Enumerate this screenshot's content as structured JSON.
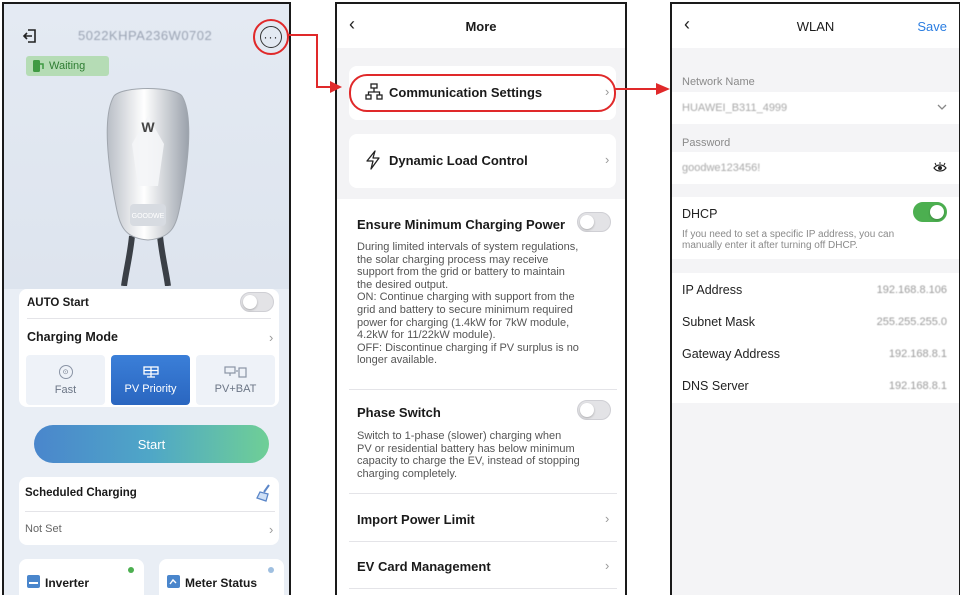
{
  "screen1": {
    "device_serial": "5022KHPA236W0702",
    "status": "Waiting",
    "charger_brand": "GOODWE",
    "auto_start": {
      "label": "AUTO Start",
      "enabled": false
    },
    "charging_mode": {
      "title": "Charging Mode",
      "modes": [
        {
          "label": "Fast",
          "active": false
        },
        {
          "label": "PV Priority",
          "active": true
        },
        {
          "label": "PV+BAT",
          "active": false
        }
      ]
    },
    "start_label": "Start",
    "scheduled": {
      "title": "Scheduled Charging",
      "value": "Not Set"
    },
    "tiles": [
      {
        "label": "Inverter",
        "status_color": "#4caf50"
      },
      {
        "label": "Meter Status",
        "status_color": "#9fbfe0"
      }
    ]
  },
  "screen2": {
    "title": "More",
    "communication_settings": "Communication Settings",
    "dynamic_load_control": "Dynamic Load Control",
    "ensure_min": {
      "label": "Ensure Minimum Charging Power",
      "enabled": false,
      "lines": [
        "During limited intervals of system regulations,",
        "the solar charging process may receive",
        "support from the grid or battery to maintain",
        "the desired output.",
        "ON: Continue charging with support from the",
        "grid and battery to secure minimum required",
        "power for charging (1.4kW for 7kW module,",
        "4.2kW for 11/22kW module).",
        "OFF:  Discontinue charging if PV surplus is no",
        "longer available."
      ]
    },
    "phase_switch": {
      "label": "Phase Switch",
      "enabled": false,
      "lines": [
        "Switch to 1-phase (slower) charging when",
        "PV or residential battery has below minimum",
        "capacity to charge the EV, instead of stopping",
        "charging completely."
      ]
    },
    "import_power_limit": "Import Power Limit",
    "ev_card_management": "EV Card Management"
  },
  "screen3": {
    "title": "WLAN",
    "save_label": "Save",
    "network_name_label": "Network Name",
    "network_name_value": "HUAWEI_B311_4999",
    "password_label": "Password",
    "password_value": "goodwe123456!",
    "dhcp": {
      "label": "DHCP",
      "enabled": true,
      "hint1": "If you need to set a specific IP address, you can",
      "hint2": "manually enter it after turning off DHCP."
    },
    "fields": [
      {
        "label": "IP Address",
        "value": "192.168.8.106"
      },
      {
        "label": "Subnet Mask",
        "value": "255.255.255.0"
      },
      {
        "label": "Gateway Address",
        "value": "192.168.8.1"
      },
      {
        "label": "DNS Server",
        "value": "192.168.8.1"
      }
    ]
  },
  "colors": {
    "highlight_red": "#e0292a",
    "primary_blue": "#2a66c0",
    "toggle_green": "#4caf50",
    "save_blue": "#2a7de1"
  }
}
